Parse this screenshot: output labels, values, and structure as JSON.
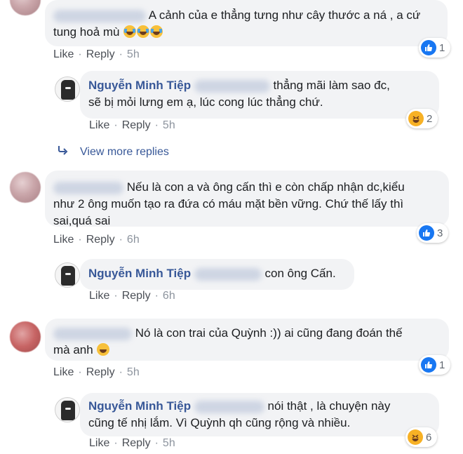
{
  "actions": {
    "like": "Like",
    "reply": "Reply",
    "separator": "·"
  },
  "comments": [
    {
      "text": "A cảnh của e thẳng tưng như cây thước a ná , a cứ tung hoả mù",
      "time": "5h",
      "reactions": {
        "type": "like-icon",
        "count": "1"
      }
    },
    {
      "author": "Nguyễn Minh Tiệp",
      "text_line1": "thẳng mãi làm sao đc,",
      "text_line2": "sẽ bị mỏi lưng em ạ, lúc cong lúc thẳng chứ.",
      "time": "5h",
      "reactions": {
        "type": "haha-icon",
        "count": "2"
      }
    },
    {
      "text_line1": "Nếu là con a và ông cấn thì e còn chấp nhận dc,kiểu",
      "text_line2": "như 2 ông muốn tạo ra đứa có máu mặt bền vững. Chứ thế lấy thì",
      "text_line3": "sai,quá sai",
      "time": "6h",
      "reactions": {
        "type": "like-icon",
        "count": "3"
      }
    },
    {
      "author": "Nguyễn Minh Tiệp",
      "text": "con ông Cấn.",
      "time": "6h"
    },
    {
      "text_line1": "Nó là con trai của Quỳnh :)) ai cũng đang đoán thế",
      "text_line2": "mà anh",
      "time": "5h",
      "reactions": {
        "type": "like-icon",
        "count": "1"
      }
    },
    {
      "author": "Nguyễn Minh Tiệp",
      "text_line1": "nói thật , là chuyện này",
      "text_line2": "cũng tế nhị lắm. Vì Quỳnh qh cũng rộng và nhiều.",
      "time": "5h",
      "reactions": {
        "type": "haha-icon",
        "count": "6"
      }
    }
  ],
  "view_more": {
    "label": "View more replies",
    "icon": "reply-arrow-icon"
  },
  "colors": {
    "link": "#385898",
    "bubble": "#f2f3f5",
    "like": "#1877f2",
    "haha": "#f7b125"
  }
}
